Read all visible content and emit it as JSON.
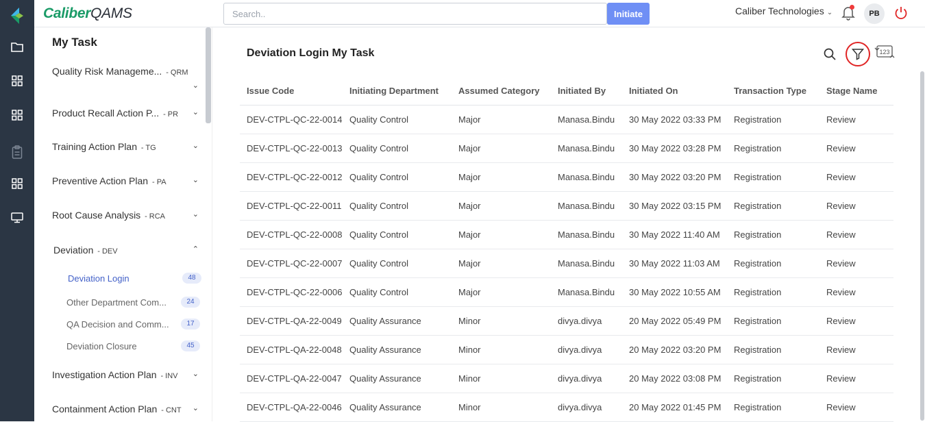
{
  "header": {
    "brand_part1": "Caliber",
    "brand_part2": "QAMS",
    "search_placeholder": "Search..",
    "initiate_label": "Initiate",
    "company": "Caliber Technologies",
    "avatar_initials": "PB"
  },
  "sidebar": {
    "title": "My Task",
    "items": [
      {
        "label": "Quality Risk Manageme...",
        "code": "- QRM"
      },
      {
        "label": "Product Recall Action P...",
        "code": "- PR"
      },
      {
        "label": "Training Action Plan",
        "code": "- TG"
      },
      {
        "label": "Preventive Action Plan",
        "code": "- PA"
      },
      {
        "label": "Root Cause Analysis",
        "code": "- RCA"
      },
      {
        "label": "Deviation",
        "code": "- DEV"
      },
      {
        "label": "Investigation Action Plan",
        "code": "- INV"
      },
      {
        "label": "Containment Action Plan",
        "code": "- CNT"
      }
    ],
    "sub_items": [
      {
        "label": "Deviation Login",
        "count": "48"
      },
      {
        "label": "Other Department Com...",
        "count": "24"
      },
      {
        "label": "QA Decision and Comm...",
        "count": "17"
      },
      {
        "label": "Deviation Closure",
        "count": "45"
      }
    ]
  },
  "main": {
    "title": "Deviation Login My Task",
    "columns": [
      "Issue Code",
      "Initiating Department",
      "Assumed Category",
      "Initiated By",
      "Initiated On",
      "Transaction Type",
      "Stage Name"
    ],
    "rows": [
      [
        "DEV-CTPL-QC-22-0014",
        "Quality Control",
        "Major",
        "Manasa.Bindu",
        "30 May 2022 03:33 PM",
        "Registration",
        "Review"
      ],
      [
        "DEV-CTPL-QC-22-0013",
        "Quality Control",
        "Major",
        "Manasa.Bindu",
        "30 May 2022 03:28 PM",
        "Registration",
        "Review"
      ],
      [
        "DEV-CTPL-QC-22-0012",
        "Quality Control",
        "Major",
        "Manasa.Bindu",
        "30 May 2022 03:20 PM",
        "Registration",
        "Review"
      ],
      [
        "DEV-CTPL-QC-22-0011",
        "Quality Control",
        "Major",
        "Manasa.Bindu",
        "30 May 2022 03:15 PM",
        "Registration",
        "Review"
      ],
      [
        "DEV-CTPL-QC-22-0008",
        "Quality Control",
        "Major",
        "Manasa.Bindu",
        "30 May 2022 11:40 AM",
        "Registration",
        "Review"
      ],
      [
        "DEV-CTPL-QC-22-0007",
        "Quality Control",
        "Major",
        "Manasa.Bindu",
        "30 May 2022 11:03 AM",
        "Registration",
        "Review"
      ],
      [
        "DEV-CTPL-QC-22-0006",
        "Quality Control",
        "Major",
        "Manasa.Bindu",
        "30 May 2022 10:55 AM",
        "Registration",
        "Review"
      ],
      [
        "DEV-CTPL-QA-22-0049",
        "Quality Assurance",
        "Minor",
        "divya.divya",
        "20 May 2022 05:49 PM",
        "Registration",
        "Review"
      ],
      [
        "DEV-CTPL-QA-22-0048",
        "Quality Assurance",
        "Minor",
        "divya.divya",
        "20 May 2022 03:20 PM",
        "Registration",
        "Review"
      ],
      [
        "DEV-CTPL-QA-22-0047",
        "Quality Assurance",
        "Minor",
        "divya.divya",
        "20 May 2022 03:08 PM",
        "Registration",
        "Review"
      ],
      [
        "DEV-CTPL-QA-22-0046",
        "Quality Assurance",
        "Minor",
        "divya.divya",
        "20 May 2022 01:45 PM",
        "Registration",
        "Review"
      ]
    ]
  },
  "icons": {
    "rail": [
      "folder-icon",
      "grid-icon",
      "grid-icon",
      "clipboard-icon",
      "grid-icon",
      "monitor-icon"
    ],
    "toolbar": [
      "search-icon",
      "filter-icon",
      "number-toggle-icon"
    ]
  },
  "colors": {
    "rail_bg": "#2b3644",
    "brand_green": "#1a9b67",
    "initiate_button": "#6f8ff5",
    "active_link": "#4361c8",
    "filter_highlight": "#e02424"
  }
}
